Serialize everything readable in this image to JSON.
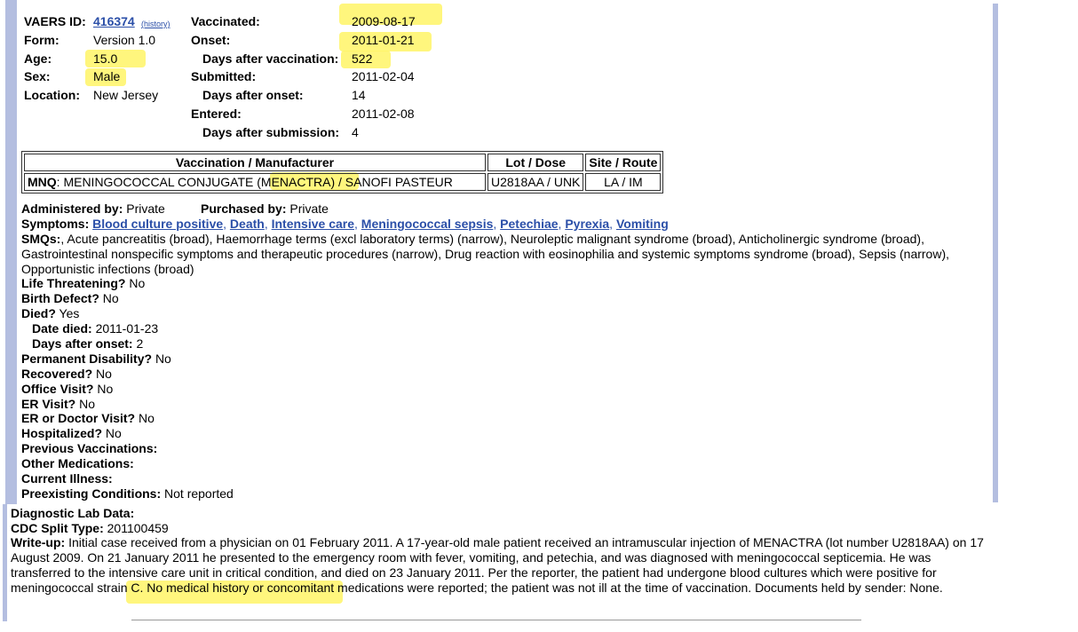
{
  "header": {
    "vaers_id_label": "VAERS ID:",
    "vaers_id": "416374",
    "history_link": "(history)",
    "form_label": "Form:",
    "form": "Version 1.0",
    "age_label": "Age:",
    "age": "15.0",
    "sex_label": "Sex:",
    "sex": "Male",
    "location_label": "Location:",
    "location": "New Jersey",
    "vaccinated_label": "Vaccinated:",
    "vaccinated": "2009-08-17",
    "onset_label": "Onset:",
    "onset": "2011-01-21",
    "days_after_vacc_label": "Days after vaccination:",
    "days_after_vacc": "522",
    "submitted_label": "Submitted:",
    "submitted": "2011-02-04",
    "days_after_onset_label": "Days after onset:",
    "days_after_onset": "14",
    "entered_label": "Entered:",
    "entered": "2011-02-08",
    "days_after_sub_label": "Days after submission:",
    "days_after_sub": "4"
  },
  "vaccination_table": {
    "headers": [
      "Vaccination / Manufacturer",
      "Lot / Dose",
      "Site / Route"
    ],
    "row": {
      "code": "MNQ",
      "name_prefix": ": MENINGOCOCCAL CONJUGATE ",
      "brand": "(MENACTRA)",
      "name_suffix": " / SANOFI PASTEUR",
      "lot": "U2818AA / UNK",
      "site": "LA / IM"
    }
  },
  "details": {
    "administered_label": "Administered by:",
    "administered": "Private",
    "purchased_label": "Purchased by:",
    "purchased": "Private",
    "symptoms_label": "Symptoms:",
    "symptoms": [
      "Blood culture positive",
      "Death",
      "Intensive care",
      "Meningococcal sepsis",
      "Petechiae",
      "Pyrexia",
      "Vomiting"
    ],
    "smqs_label": "SMQs:",
    "smqs_text": ", Acute pancreatitis (broad), Haemorrhage terms (excl laboratory terms) (narrow), Neuroleptic malignant syndrome (broad), Anticholinergic syndrome (broad), Gastrointestinal nonspecific symptoms and therapeutic procedures (narrow), Drug reaction with eosinophilia and systemic symptoms syndrome (broad), Sepsis (narrow), Opportunistic infections (broad)",
    "life_threatening_label": "Life Threatening?",
    "life_threatening": "No",
    "birth_defect_label": "Birth Defect?",
    "birth_defect": "No",
    "died_label": "Died?",
    "died": "Yes",
    "date_died_label": "Date died:",
    "date_died": "2011-01-23",
    "days_after_onset_died_label": "Days after onset:",
    "days_after_onset_died": "2",
    "perm_disability_label": "Permanent Disability?",
    "perm_disability": "No",
    "recovered_label": "Recovered?",
    "recovered": "No",
    "office_visit_label": "Office Visit?",
    "office_visit": "No",
    "er_visit_label": "ER Visit?",
    "er_visit": "No",
    "er_doctor_label": "ER or Doctor Visit?",
    "er_doctor": "No",
    "hospitalized_label": "Hospitalized?",
    "hospitalized": "No",
    "prev_vacc_label": "Previous Vaccinations:",
    "other_meds_label": "Other Medications:",
    "current_illness_label": "Current Illness:",
    "preexisting_label": "Preexisting Conditions:",
    "preexisting": "Not reported"
  },
  "lower": {
    "diag_label": "Diagnostic Lab Data:",
    "cdc_label": "CDC Split Type:",
    "cdc": "201100459",
    "writeup_label": "Write-up:",
    "writeup_pre": " Initial case received from a physician on 01 February 2011. A 17-year-old male patient received an intramuscular injection of MENACTRA (lot number U2818AA) on 17 August 2009. On 21 January 2011 he presented to the emergency room with fever, vomiting, and petechia, and was diagnosed with meningococcal septicemia. He was transferred to the intensive care unit in critical condition, and died on 23 January 2011. Per the reporter, the patient had undergone blood cultures which were ",
    "writeup_highlight": "positive for meningococcal strain C.",
    "writeup_post": " No medical history or concomitant medications were reported; the patient was not ill at the time of vaccination. Documents held by sender: None."
  },
  "colors": {
    "highlight": "#fff566",
    "link": "#2b4fa8",
    "side_bar": "#b4bee0"
  }
}
